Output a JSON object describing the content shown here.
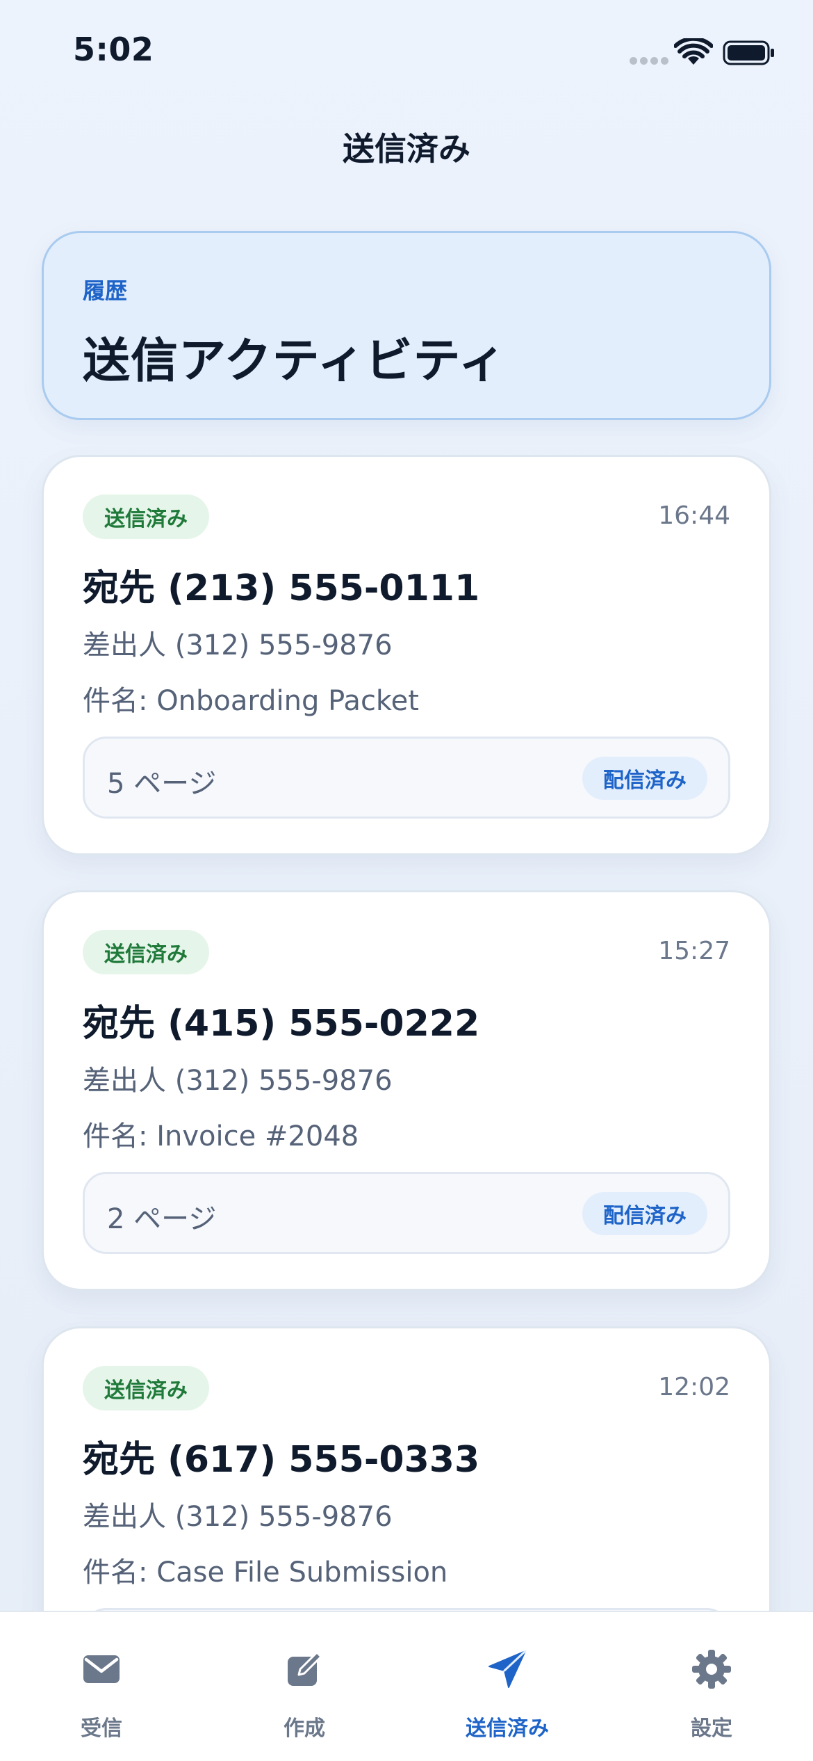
{
  "status_bar": {
    "time": "5:02"
  },
  "nav": {
    "title": "送信済み"
  },
  "hero": {
    "eyebrow": "履歴",
    "title": "送信アクティビティ"
  },
  "faxes": [
    {
      "status": "送信済み",
      "time": "16:44",
      "to": "宛先 (213) 555-0111",
      "from": "差出人 (312) 555-9876",
      "subject": "件名: Onboarding Packet",
      "pages": "5 ページ",
      "delivery": "配信済み"
    },
    {
      "status": "送信済み",
      "time": "15:27",
      "to": "宛先 (415) 555-0222",
      "from": "差出人 (312) 555-9876",
      "subject": "件名: Invoice #2048",
      "pages": "2 ページ",
      "delivery": "配信済み"
    },
    {
      "status": "送信済み",
      "time": "12:02",
      "to": "宛先 (617) 555-0333",
      "from": "差出人 (312) 555-9876",
      "subject": "件名: Case File Submission",
      "pages": "",
      "delivery": ""
    }
  ],
  "tabs": [
    {
      "label": "受信",
      "icon": "inbox-icon"
    },
    {
      "label": "作成",
      "icon": "compose-icon"
    },
    {
      "label": "送信済み",
      "icon": "send-icon"
    },
    {
      "label": "設定",
      "icon": "gear-icon"
    }
  ],
  "active_tab": "送信済み",
  "colors": {
    "accent": "#1e64c8",
    "sent_badge": "#1f7a3a",
    "background": "#edf3fc"
  }
}
